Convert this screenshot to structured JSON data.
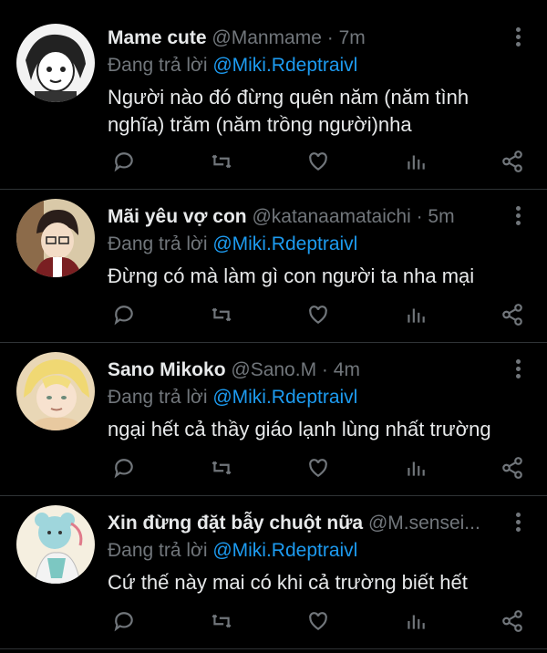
{
  "tweets": [
    {
      "name": "Mame cute",
      "handle": "@Manmame",
      "separator": "·",
      "time": "7m",
      "reply_prefix": "Đang trả lời",
      "reply_to": "@Miki.Rdeptraivl",
      "body": "Người nào đó đừng quên năm (năm tình nghĩa) trăm (năm trồng người)nha"
    },
    {
      "name": "Mãi yêu vợ con",
      "handle": "@katanaamataichi",
      "separator": "·",
      "time": "5m",
      "reply_prefix": "Đang trả lời",
      "reply_to": "@Miki.Rdeptraivl",
      "body": "Đừng có mà làm gì con người ta nha mại"
    },
    {
      "name": "Sano Mikoko",
      "handle": "@Sano.M",
      "separator": "·",
      "time": "4m",
      "reply_prefix": "Đang trả lời",
      "reply_to": "@Miki.Rdeptraivl",
      "body": "ngại hết cả thầy giáo lạnh lùng nhất trường"
    },
    {
      "name": "Xin đừng đặt bẫy chuột nữa",
      "handle": "@M.sensei...",
      "separator": "",
      "time": "",
      "reply_prefix": "Đang trả lời",
      "reply_to": "@Miki.Rdeptraivl",
      "body": "Cứ thế này mai có khi cả trường biết hết"
    }
  ],
  "icons": [
    "reply-icon",
    "retweet-icon",
    "like-icon",
    "analytics-icon",
    "share-icon"
  ],
  "colors": {
    "background": "#000000",
    "text": "#e7e9ea",
    "muted": "#71767b",
    "mention": "#1d9bf0",
    "divider": "#2f3336"
  }
}
